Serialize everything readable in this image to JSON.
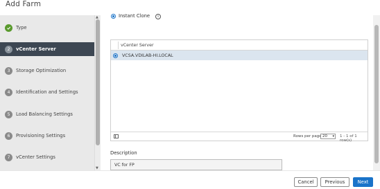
{
  "header": {
    "title": "Add Farm"
  },
  "steps": [
    {
      "number": "✓",
      "label": "Type",
      "state": "done"
    },
    {
      "number": "2",
      "label": "vCenter Server",
      "state": "active"
    },
    {
      "number": "3",
      "label": "Storage Optimization",
      "state": "pending"
    },
    {
      "number": "4",
      "label": "Identification and Settings",
      "state": "pending"
    },
    {
      "number": "5",
      "label": "Load Balancing Settings",
      "state": "pending"
    },
    {
      "number": "6",
      "label": "Provisioning Settings",
      "state": "pending"
    },
    {
      "number": "7",
      "label": "vCenter Settings",
      "state": "pending"
    }
  ],
  "clone": {
    "label": "Instant Clone",
    "info_icon": "i"
  },
  "table": {
    "column": "vCenter Server",
    "rows": [
      {
        "name": "VCSA.VDILAB-HI.LOCAL",
        "selected": true
      }
    ],
    "rows_per_page_label": "Rows per page",
    "rows_per_page_value": "20",
    "range": "1 - 1 of 1 row(s)"
  },
  "description": {
    "label": "Description",
    "value": "VC for FP"
  },
  "buttons": {
    "cancel": "Cancel",
    "previous": "Previous",
    "next": "Next"
  },
  "colors": {
    "accent": "#1a73c9",
    "active_step": "#3d4753",
    "done_step": "#5a9a2e"
  }
}
